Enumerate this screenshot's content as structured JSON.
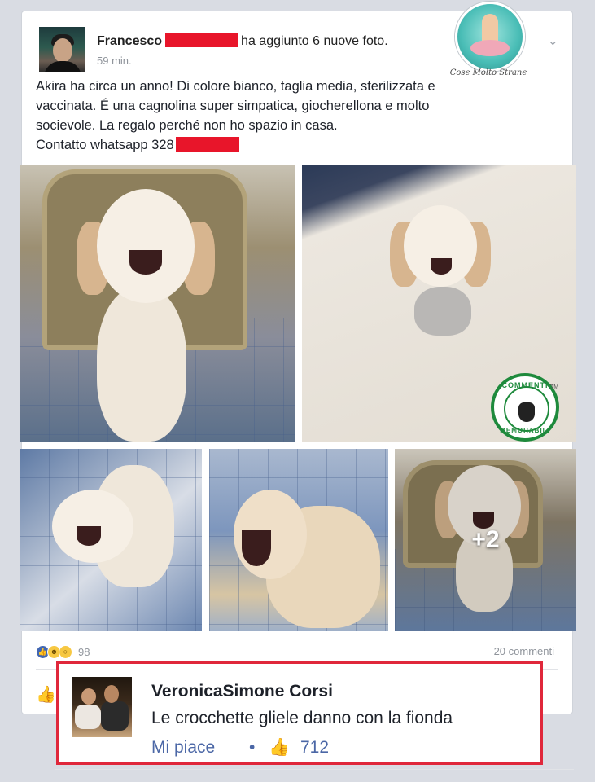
{
  "post": {
    "author": "Francesco",
    "action": "ha aggiunto 6 nuove foto.",
    "time": "59 min.",
    "text_lines": [
      "Akira ha circa un anno! Di colore bianco, taglia media, sterilizzata e",
      "vaccinata. É una cagnolina super simpatica, giocherellona e molto",
      "socievole. La regalo perché non ho spazio in casa.",
      "Contatto whatsapp 328"
    ],
    "extra_photos": "+2",
    "reaction_count": "98",
    "comments_count": "20 commenti",
    "reactions": [
      "like-icon",
      "haha-icon",
      "wow-icon"
    ]
  },
  "watermark": {
    "text": "Cose Molto Strane"
  },
  "badge": {
    "top_text": "COMMENTI",
    "bottom_text": "MEMORABILI",
    "tm": "TM"
  },
  "comment": {
    "author": "VeronicaSimone Corsi",
    "text": "Le crocchette gliele danno con la fionda",
    "like_label": "Mi piace",
    "separator": "•",
    "like_count": "712"
  },
  "colors": {
    "redaction": "#e8152a",
    "highlight_border": "#e0283b",
    "link_blue": "#4b67a6",
    "badge_green": "#1e8a3c"
  }
}
